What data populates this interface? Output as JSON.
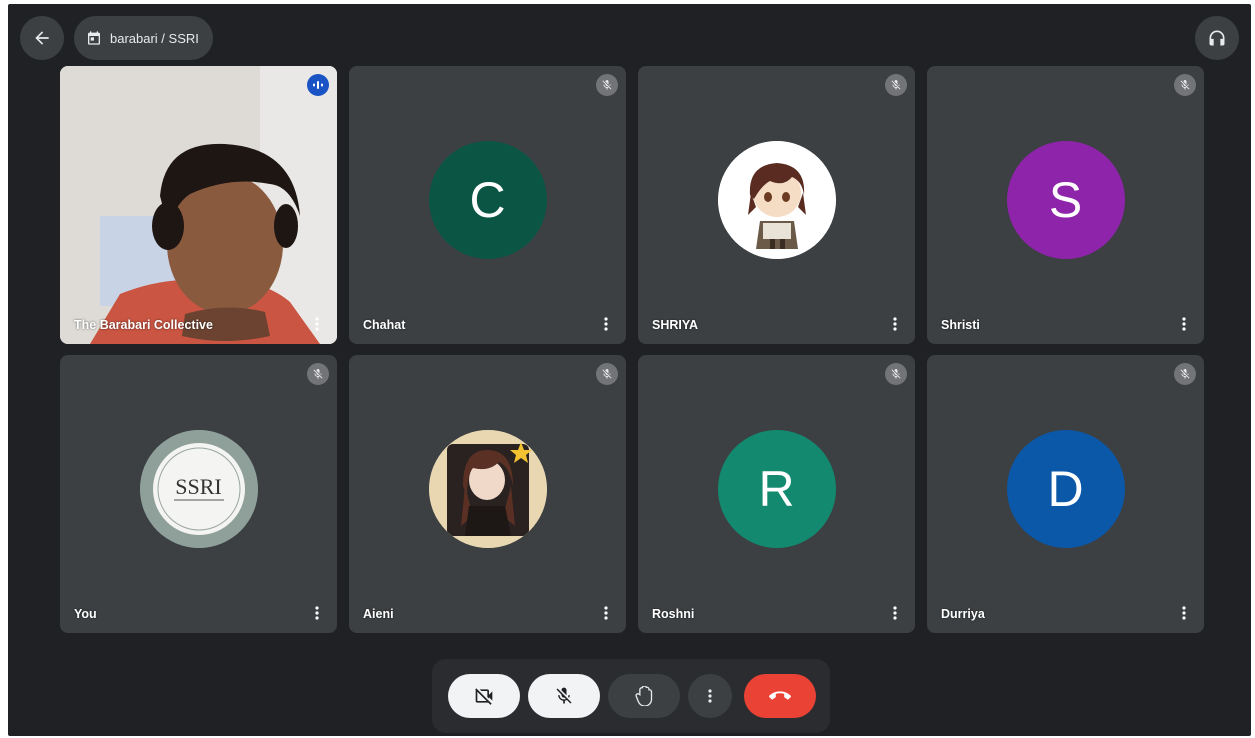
{
  "meeting": {
    "title": "barabari / SSRI"
  },
  "colors": {
    "background": "#202124",
    "tile": "#3c4043",
    "end_call": "#ea4335",
    "speaking": "#1a53c4"
  },
  "participants": [
    {
      "name": "The Barabari Collective",
      "type": "video",
      "muted": false,
      "speaking": true
    },
    {
      "name": "Chahat",
      "type": "initial",
      "initial": "C",
      "avatar_color": "#0b5545",
      "muted": true
    },
    {
      "name": "SHRIYA",
      "type": "image",
      "image": "anime-character-avatar",
      "muted": true
    },
    {
      "name": "Shristi",
      "type": "initial",
      "initial": "S",
      "avatar_color": "#8e24aa",
      "muted": true
    },
    {
      "name": "You",
      "type": "image",
      "image": "ssri-logo",
      "logo_text": "SSRI",
      "muted": true
    },
    {
      "name": "Aieni",
      "type": "image",
      "image": "anime-girl-avatar",
      "muted": true
    },
    {
      "name": "Roshni",
      "type": "initial",
      "initial": "R",
      "avatar_color": "#138a6f",
      "muted": true
    },
    {
      "name": "Durriya",
      "type": "initial",
      "initial": "D",
      "avatar_color": "#0b57a8",
      "muted": true
    }
  ],
  "controls": [
    {
      "name": "camera-off",
      "icon": "video-off-icon",
      "state": "off"
    },
    {
      "name": "microphone-off",
      "icon": "mic-off-icon",
      "state": "off"
    },
    {
      "name": "raise-hand",
      "icon": "hand-icon"
    },
    {
      "name": "more-options",
      "icon": "more-vert-icon"
    },
    {
      "name": "leave-call",
      "icon": "call-end-icon"
    }
  ]
}
